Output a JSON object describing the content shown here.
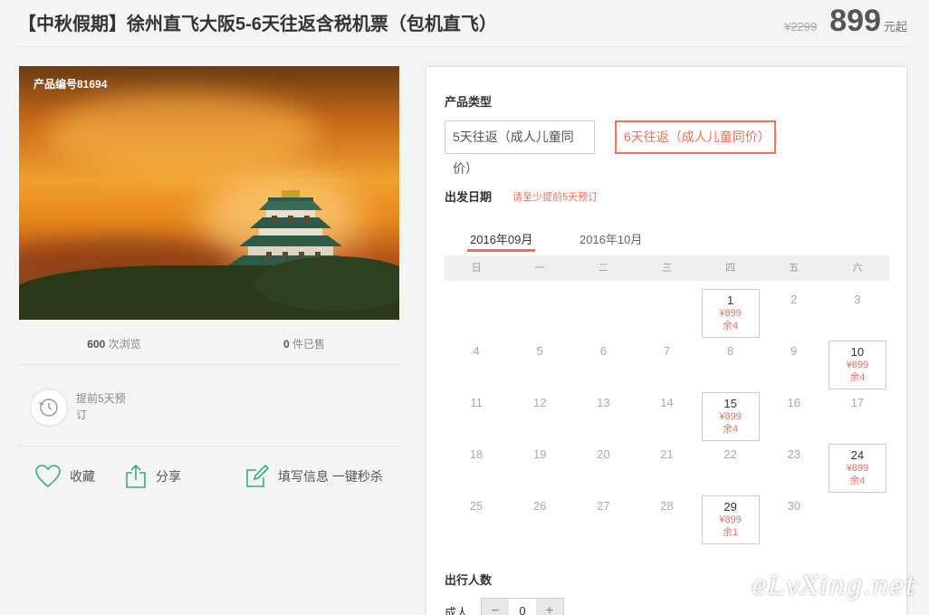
{
  "header": {
    "title": "【中秋假期】徐州直飞大阪5-6天往返含税机票（包机直飞）",
    "old_price": "¥2299",
    "price": "899",
    "price_unit": "元起"
  },
  "photo": {
    "product_code": "产品编号81694"
  },
  "stats": {
    "views_count": "600",
    "views_label": "次浏览",
    "sold_count": "0",
    "sold_label": "件已售"
  },
  "advance_notice": "提前5天预订",
  "actions": {
    "favorite": "收藏",
    "share": "分享",
    "fill_info": "填写信息 一键秒杀"
  },
  "product_type": {
    "label": "产品类型",
    "options": [
      "5天往返（成人儿童同价）",
      "6天往返（成人儿童同价）"
    ],
    "selected": 1
  },
  "departure": {
    "label": "出发日期",
    "hint": "请至少提前5天预订",
    "months": [
      "2016年09月",
      "2016年10月"
    ],
    "active_month": 0,
    "weekdays": [
      "日",
      "一",
      "二",
      "三",
      "四",
      "五",
      "六"
    ],
    "weeks": [
      [
        null,
        null,
        null,
        null,
        {
          "day": "1",
          "price": "¥899",
          "stock": "余4"
        },
        {
          "day": "2"
        },
        {
          "day": "3"
        }
      ],
      [
        {
          "day": "4"
        },
        {
          "day": "5"
        },
        {
          "day": "6"
        },
        {
          "day": "7"
        },
        {
          "day": "8"
        },
        {
          "day": "9"
        },
        {
          "day": "10",
          "price": "¥899",
          "stock": "余4"
        }
      ],
      [
        {
          "day": "11"
        },
        {
          "day": "12"
        },
        {
          "day": "13"
        },
        {
          "day": "14"
        },
        {
          "day": "15",
          "price": "¥899",
          "stock": "余4"
        },
        {
          "day": "16"
        },
        {
          "day": "17"
        }
      ],
      [
        {
          "day": "18"
        },
        {
          "day": "19"
        },
        {
          "day": "20"
        },
        {
          "day": "21"
        },
        {
          "day": "22"
        },
        {
          "day": "23"
        },
        {
          "day": "24",
          "price": "¥899",
          "stock": "余4"
        }
      ],
      [
        {
          "day": "25"
        },
        {
          "day": "26"
        },
        {
          "day": "27"
        },
        {
          "day": "28"
        },
        {
          "day": "29",
          "price": "¥899",
          "stock": "余1"
        },
        {
          "day": "30"
        },
        null
      ]
    ]
  },
  "travelers": {
    "label": "出行人数",
    "adult_label": "成人",
    "adult_value": "0",
    "minus": "−",
    "plus": "+"
  },
  "watermark": "eLvXing.net",
  "colors": {
    "accent": "#f06e5a",
    "icon_green": "#3aaa7a"
  }
}
